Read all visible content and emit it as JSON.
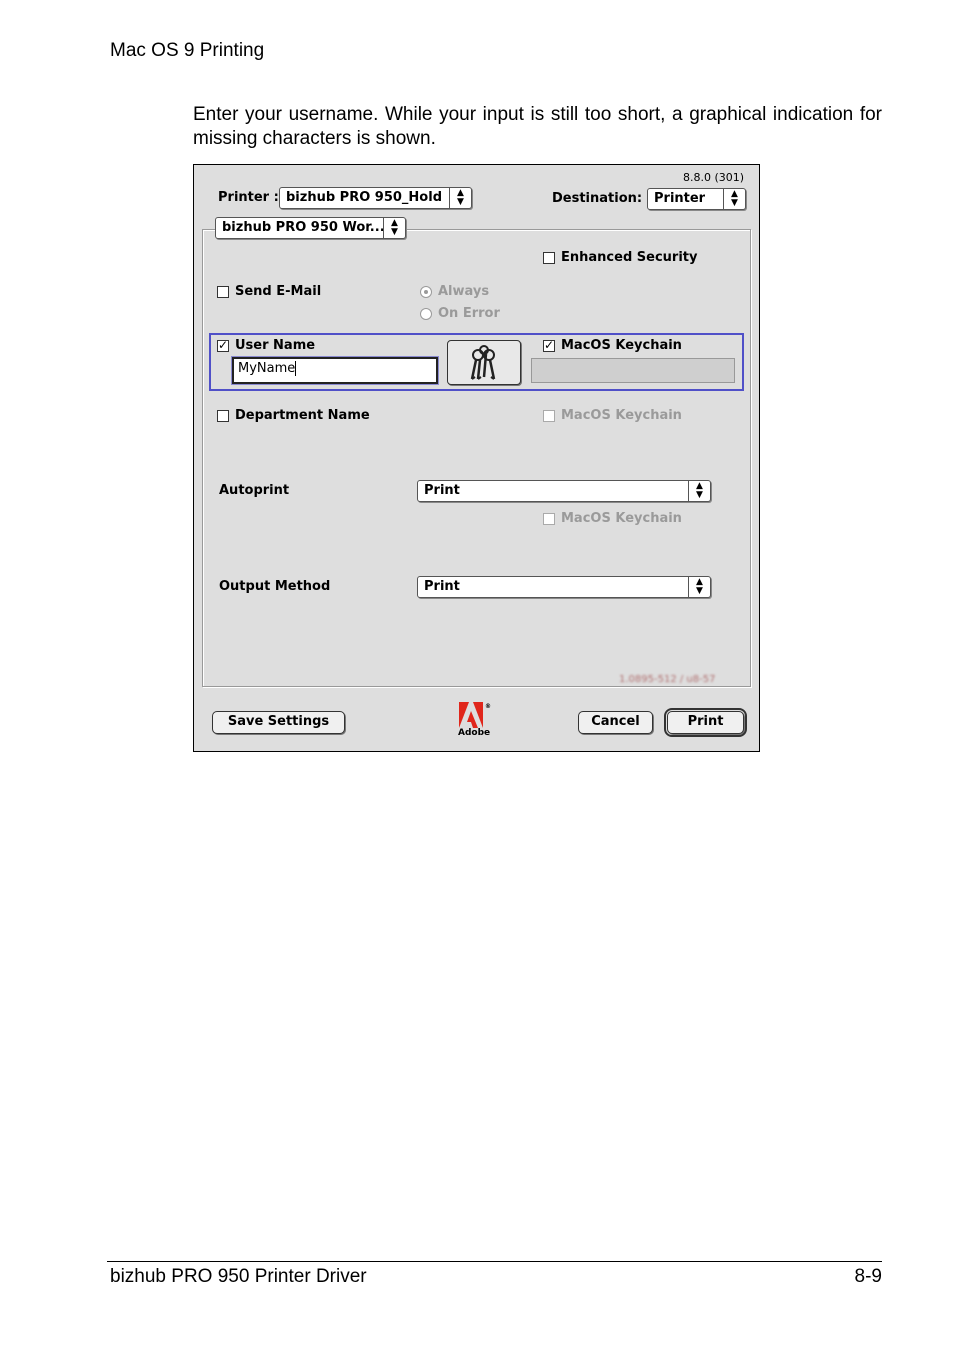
{
  "page": {
    "header": "Mac OS 9 Printing",
    "intro": "Enter your username. While your input is still too short, a graphical indication for missing characters is shown.",
    "footer_left": "bizhub PRO 950 Printer Driver",
    "footer_right": "8-9"
  },
  "dialog": {
    "version": "8.8.0 (301)",
    "printer_label": "Printer :",
    "printer_value": "bizhub PRO 950_Hold",
    "destination_label": "Destination:",
    "destination_value": "Printer",
    "panel_popup": "bizhub PRO 950 Wor...",
    "enhanced_security": {
      "label": "Enhanced Security",
      "checked": false
    },
    "send_email": {
      "label": "Send E-Mail",
      "checked": false
    },
    "always": {
      "label": "Always",
      "selected": true,
      "enabled": false
    },
    "on_error": {
      "label": "On Error",
      "selected": false,
      "enabled": false
    },
    "user_name": {
      "label": "User Name",
      "checked": true,
      "value": "MyName"
    },
    "macos_keychain_1": {
      "label": "MacOS Keychain",
      "checked": true
    },
    "department_name": {
      "label": "Department Name",
      "checked": false
    },
    "macos_keychain_2": {
      "label": "MacOS Keychain",
      "checked": false,
      "enabled": false
    },
    "autoprint_label": "Autoprint",
    "autoprint_value": "Print",
    "macos_keychain_3": {
      "label": "MacOS Keychain",
      "checked": false,
      "enabled": false
    },
    "output_method_label": "Output Method",
    "output_method_value": "Print",
    "blurred_text": "1.0895-512 / u8-57",
    "save_settings": "Save Settings",
    "adobe_label": "Adobe",
    "cancel": "Cancel",
    "print": "Print"
  },
  "icons": {
    "keys": "keys-icon",
    "adobe": "adobe-logo",
    "popup_arrows": "up-down-arrows-icon"
  },
  "colors": {
    "dialog_bg": "#dedede",
    "focus_ring": "#5050c8",
    "adobe_red": "#e0261b"
  }
}
